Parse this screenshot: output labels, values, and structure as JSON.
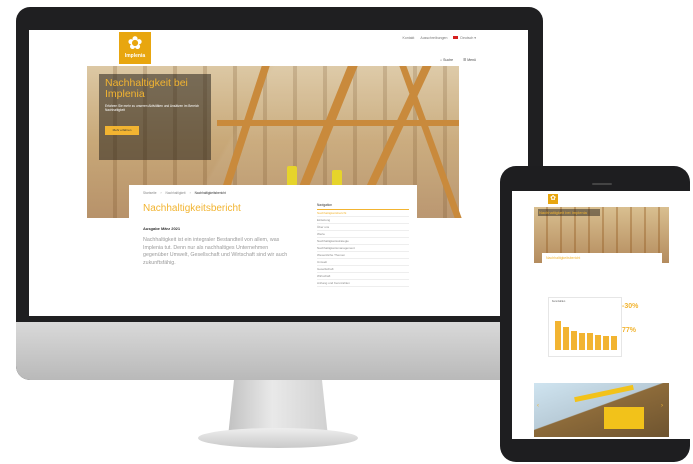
{
  "desktop": {
    "logo_text": "Implenia",
    "top_links": [
      "Kontakt",
      "Ausschreibungen",
      "Deutsch"
    ],
    "nav": {
      "search_label": "Suche",
      "menu_label": "Menü"
    },
    "hero": {
      "title": "Nachhaltigkeit bei Implenia",
      "subtitle": "Erfahren Sie mehr zu unseren Aktivitäten und Ansätzen im Bereich Nachhaltigkeit",
      "button_label": "Mehr erfahren"
    },
    "breadcrumb": [
      "Startseite",
      "Nachhaltigkeit",
      "Nachhaltigkeitsbericht"
    ],
    "article": {
      "title": "Nachhaltigkeitsbericht",
      "subhead": "Ausgabe März 2021",
      "body": "Nachhaltigkeit ist ein integraler Bestandteil von allem, was Implenia tut. Denn nur als nachhaltiges Unternehmen gegenüber Umwelt, Gesellschaft und Wirtschaft sind wir auch zukunftsfähig."
    },
    "side_nav": {
      "heading": "Navigation",
      "items": [
        "Nachhaltigkeitsbericht",
        "Einleitung",
        "Über uns",
        "Werte",
        "Nachhaltigkeitsstrategie",
        "Nachhaltigkeitsmanagement",
        "Wesentliche Themen",
        "Umwelt",
        "Gesellschaft",
        "Wirtschaft",
        "Anhang und Kennzahlen"
      ]
    }
  },
  "tablet": {
    "hero_title": "Nachhaltigkeit bei Implenia",
    "card_title": "Nachhaltigkeitsbericht",
    "chart_heading": "Kennzahlen",
    "stats": [
      "-30%",
      "77%"
    ],
    "chart_data": {
      "type": "bar",
      "values": [
        95,
        78,
        62,
        58,
        55,
        50,
        48,
        45
      ]
    }
  },
  "colors": {
    "accent": "#f2b431",
    "frame": "#1f1f21",
    "logo_bg": "#e8a60f"
  }
}
